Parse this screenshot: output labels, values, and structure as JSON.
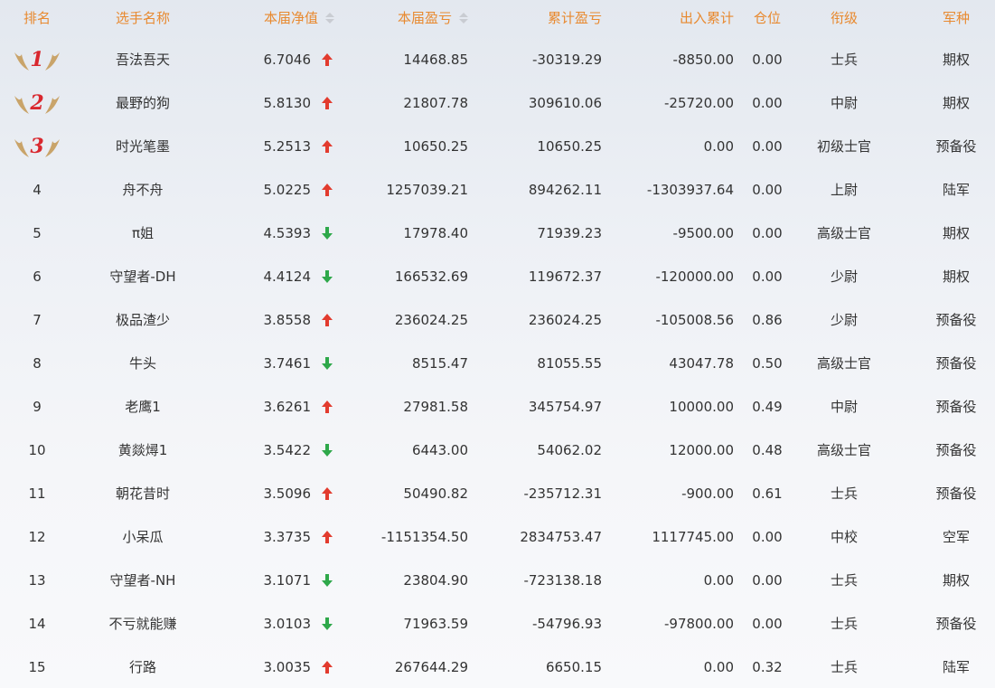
{
  "header": {
    "rank": "排名",
    "name": "选手名称",
    "nav": "本届净值",
    "pnl": "本届盈亏",
    "cum_pnl": "累计盈亏",
    "flow": "出入累计",
    "position": "仓位",
    "title": "衔级",
    "arm": "军种"
  },
  "colors": {
    "header_text": "#e8892f",
    "arrow_up": "#e23b2e",
    "arrow_down": "#2ea84a",
    "medal_number": "#d9272e",
    "wing": "#c9a46a"
  },
  "rows": [
    {
      "rank": "1",
      "medal": true,
      "name": "吾法吾天",
      "nav": "6.7046",
      "trend": "up",
      "pnl": "14468.85",
      "cum_pnl": "-30319.29",
      "flow": "-8850.00",
      "position": "0.00",
      "title": "士兵",
      "arm": "期权"
    },
    {
      "rank": "2",
      "medal": true,
      "name": "最野的狗",
      "nav": "5.8130",
      "trend": "up",
      "pnl": "21807.78",
      "cum_pnl": "309610.06",
      "flow": "-25720.00",
      "position": "0.00",
      "title": "中尉",
      "arm": "期权"
    },
    {
      "rank": "3",
      "medal": true,
      "name": "时光笔墨",
      "nav": "5.2513",
      "trend": "up",
      "pnl": "10650.25",
      "cum_pnl": "10650.25",
      "flow": "0.00",
      "position": "0.00",
      "title": "初级士官",
      "arm": "预备役"
    },
    {
      "rank": "4",
      "medal": false,
      "name": "舟不舟",
      "nav": "5.0225",
      "trend": "up",
      "pnl": "1257039.21",
      "cum_pnl": "894262.11",
      "flow": "-1303937.64",
      "position": "0.00",
      "title": "上尉",
      "arm": "陆军"
    },
    {
      "rank": "5",
      "medal": false,
      "name": "π姐",
      "nav": "4.5393",
      "trend": "down",
      "pnl": "17978.40",
      "cum_pnl": "71939.23",
      "flow": "-9500.00",
      "position": "0.00",
      "title": "高级士官",
      "arm": "期权"
    },
    {
      "rank": "6",
      "medal": false,
      "name": "守望者-DH",
      "nav": "4.4124",
      "trend": "down",
      "pnl": "166532.69",
      "cum_pnl": "119672.37",
      "flow": "-120000.00",
      "position": "0.00",
      "title": "少尉",
      "arm": "期权"
    },
    {
      "rank": "7",
      "medal": false,
      "name": "极品渣少",
      "nav": "3.8558",
      "trend": "up",
      "pnl": "236024.25",
      "cum_pnl": "236024.25",
      "flow": "-105008.56",
      "position": "0.86",
      "title": "少尉",
      "arm": "预备役"
    },
    {
      "rank": "8",
      "medal": false,
      "name": "牛头",
      "nav": "3.7461",
      "trend": "down",
      "pnl": "8515.47",
      "cum_pnl": "81055.55",
      "flow": "43047.78",
      "position": "0.50",
      "title": "高级士官",
      "arm": "预备役"
    },
    {
      "rank": "9",
      "medal": false,
      "name": "老鹰1",
      "nav": "3.6261",
      "trend": "up",
      "pnl": "27981.58",
      "cum_pnl": "345754.97",
      "flow": "10000.00",
      "position": "0.49",
      "title": "中尉",
      "arm": "预备役"
    },
    {
      "rank": "10",
      "medal": false,
      "name": "黄燚燖1",
      "nav": "3.5422",
      "trend": "down",
      "pnl": "6443.00",
      "cum_pnl": "54062.02",
      "flow": "12000.00",
      "position": "0.48",
      "title": "高级士官",
      "arm": "预备役"
    },
    {
      "rank": "11",
      "medal": false,
      "name": "朝花昔时",
      "nav": "3.5096",
      "trend": "up",
      "pnl": "50490.82",
      "cum_pnl": "-235712.31",
      "flow": "-900.00",
      "position": "0.61",
      "title": "士兵",
      "arm": "预备役"
    },
    {
      "rank": "12",
      "medal": false,
      "name": "小呆瓜",
      "nav": "3.3735",
      "trend": "up",
      "pnl": "-1151354.50",
      "cum_pnl": "2834753.47",
      "flow": "1117745.00",
      "position": "0.00",
      "title": "中校",
      "arm": "空军"
    },
    {
      "rank": "13",
      "medal": false,
      "name": "守望者-NH",
      "nav": "3.1071",
      "trend": "down",
      "pnl": "23804.90",
      "cum_pnl": "-723138.18",
      "flow": "0.00",
      "position": "0.00",
      "title": "士兵",
      "arm": "期权"
    },
    {
      "rank": "14",
      "medal": false,
      "name": "不亏就能赚",
      "nav": "3.0103",
      "trend": "down",
      "pnl": "71963.59",
      "cum_pnl": "-54796.93",
      "flow": "-97800.00",
      "position": "0.00",
      "title": "士兵",
      "arm": "预备役"
    },
    {
      "rank": "15",
      "medal": false,
      "name": "行路",
      "nav": "3.0035",
      "trend": "up",
      "pnl": "267644.29",
      "cum_pnl": "6650.15",
      "flow": "0.00",
      "position": "0.32",
      "title": "士兵",
      "arm": "陆军"
    }
  ]
}
